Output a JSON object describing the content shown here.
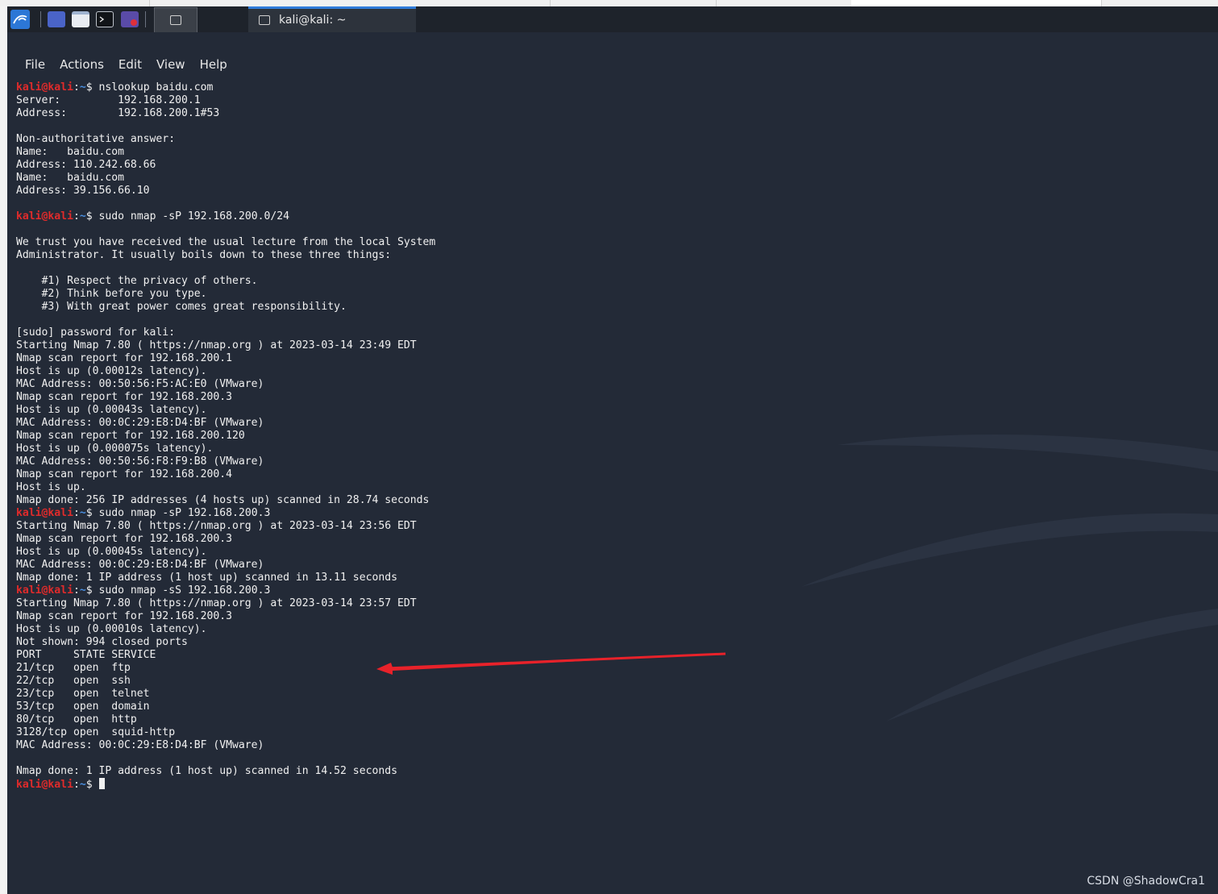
{
  "taskbar": {
    "launcher_icons": [
      "kali-menu-icon",
      "workspace-icon",
      "file-manager-icon",
      "terminal-icon",
      "screenshot-recorder-icon"
    ],
    "task_title": "kali@kali: ~"
  },
  "menu": [
    "File",
    "Actions",
    "Edit",
    "View",
    "Help"
  ],
  "prompt": {
    "user": "kali@kali",
    "sep": ":",
    "path": "~",
    "symbol": "$"
  },
  "terminal_lines": [
    {
      "type": "prompt",
      "cmd": "nslookup baidu.com"
    },
    {
      "type": "text",
      "text": "Server:         192.168.200.1"
    },
    {
      "type": "text",
      "text": "Address:        192.168.200.1#53"
    },
    {
      "type": "text",
      "text": ""
    },
    {
      "type": "text",
      "text": "Non-authoritative answer:"
    },
    {
      "type": "text",
      "text": "Name:   baidu.com"
    },
    {
      "type": "text",
      "text": "Address: 110.242.68.66"
    },
    {
      "type": "text",
      "text": "Name:   baidu.com"
    },
    {
      "type": "text",
      "text": "Address: 39.156.66.10"
    },
    {
      "type": "text",
      "text": ""
    },
    {
      "type": "prompt",
      "cmd": "sudo nmap -sP 192.168.200.0/24"
    },
    {
      "type": "text",
      "text": ""
    },
    {
      "type": "text",
      "text": "We trust you have received the usual lecture from the local System"
    },
    {
      "type": "text",
      "text": "Administrator. It usually boils down to these three things:"
    },
    {
      "type": "text",
      "text": ""
    },
    {
      "type": "text",
      "text": "    #1) Respect the privacy of others."
    },
    {
      "type": "text",
      "text": "    #2) Think before you type."
    },
    {
      "type": "text",
      "text": "    #3) With great power comes great responsibility."
    },
    {
      "type": "text",
      "text": ""
    },
    {
      "type": "text",
      "text": "[sudo] password for kali:"
    },
    {
      "type": "text",
      "text": "Starting Nmap 7.80 ( https://nmap.org ) at 2023-03-14 23:49 EDT"
    },
    {
      "type": "text",
      "text": "Nmap scan report for 192.168.200.1"
    },
    {
      "type": "text",
      "text": "Host is up (0.00012s latency)."
    },
    {
      "type": "text",
      "text": "MAC Address: 00:50:56:F5:AC:E0 (VMware)"
    },
    {
      "type": "text",
      "text": "Nmap scan report for 192.168.200.3"
    },
    {
      "type": "text",
      "text": "Host is up (0.00043s latency)."
    },
    {
      "type": "text",
      "text": "MAC Address: 00:0C:29:E8:D4:BF (VMware)"
    },
    {
      "type": "text",
      "text": "Nmap scan report for 192.168.200.120"
    },
    {
      "type": "text",
      "text": "Host is up (0.000075s latency)."
    },
    {
      "type": "text",
      "text": "MAC Address: 00:50:56:F8:F9:B8 (VMware)"
    },
    {
      "type": "text",
      "text": "Nmap scan report for 192.168.200.4"
    },
    {
      "type": "text",
      "text": "Host is up."
    },
    {
      "type": "text",
      "text": "Nmap done: 256 IP addresses (4 hosts up) scanned in 28.74 seconds"
    },
    {
      "type": "prompt",
      "cmd": "sudo nmap -sP 192.168.200.3"
    },
    {
      "type": "text",
      "text": "Starting Nmap 7.80 ( https://nmap.org ) at 2023-03-14 23:56 EDT"
    },
    {
      "type": "text",
      "text": "Nmap scan report for 192.168.200.3"
    },
    {
      "type": "text",
      "text": "Host is up (0.00045s latency)."
    },
    {
      "type": "text",
      "text": "MAC Address: 00:0C:29:E8:D4:BF (VMware)"
    },
    {
      "type": "text",
      "text": "Nmap done: 1 IP address (1 host up) scanned in 13.11 seconds"
    },
    {
      "type": "prompt",
      "cmd": "sudo nmap -sS 192.168.200.3"
    },
    {
      "type": "text",
      "text": "Starting Nmap 7.80 ( https://nmap.org ) at 2023-03-14 23:57 EDT"
    },
    {
      "type": "text",
      "text": "Nmap scan report for 192.168.200.3"
    },
    {
      "type": "text",
      "text": "Host is up (0.00010s latency)."
    },
    {
      "type": "text",
      "text": "Not shown: 994 closed ports"
    },
    {
      "type": "text",
      "text": "PORT     STATE SERVICE"
    },
    {
      "type": "text",
      "text": "21/tcp   open  ftp"
    },
    {
      "type": "text",
      "text": "22/tcp   open  ssh"
    },
    {
      "type": "text",
      "text": "23/tcp   open  telnet"
    },
    {
      "type": "text",
      "text": "53/tcp   open  domain"
    },
    {
      "type": "text",
      "text": "80/tcp   open  http"
    },
    {
      "type": "text",
      "text": "3128/tcp open  squid-http"
    },
    {
      "type": "text",
      "text": "MAC Address: 00:0C:29:E8:D4:BF (VMware)"
    },
    {
      "type": "text",
      "text": ""
    },
    {
      "type": "text",
      "text": "Nmap done: 1 IP address (1 host up) scanned in 14.52 seconds"
    },
    {
      "type": "prompt",
      "cmd": "",
      "cursor": true
    }
  ],
  "watermark": "CSDN @ShadowCra1",
  "colors": {
    "terminal_bg": "#232a37",
    "prompt_user": "#e02b2b",
    "prompt_path": "#4a8fe0",
    "annotation_arrow": "#e8222a",
    "taskbar_active": "#2f7bd9"
  }
}
